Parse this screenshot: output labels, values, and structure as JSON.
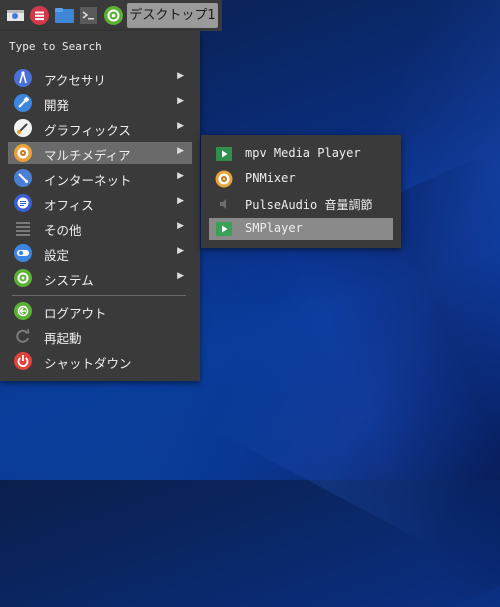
{
  "panel": {
    "workspace_label": "デスクトップ1",
    "buttons": [
      "show-desktop-icon",
      "app-menu-icon",
      "file-manager-icon",
      "terminal-icon",
      "settings-gear-icon"
    ]
  },
  "menu": {
    "search_placeholder": "Type to Search",
    "categories": [
      {
        "label": "アクセサリ",
        "icon": "accessories-icon",
        "has_submenu": true
      },
      {
        "label": "開発",
        "icon": "development-icon",
        "has_submenu": true
      },
      {
        "label": "グラフィックス",
        "icon": "graphics-icon",
        "has_submenu": true
      },
      {
        "label": "マルチメディア",
        "icon": "multimedia-icon",
        "has_submenu": true,
        "active": true
      },
      {
        "label": "インターネット",
        "icon": "internet-icon",
        "has_submenu": true
      },
      {
        "label": "オフィス",
        "icon": "office-icon",
        "has_submenu": true
      },
      {
        "label": "その他",
        "icon": "other-icon",
        "has_submenu": true
      },
      {
        "label": "設定",
        "icon": "settings-icon",
        "has_submenu": true
      },
      {
        "label": "システム",
        "icon": "system-icon",
        "has_submenu": true
      }
    ],
    "actions": [
      {
        "label": "ログアウト",
        "icon": "logout-icon"
      },
      {
        "label": "再起動",
        "icon": "reboot-icon"
      },
      {
        "label": "シャットダウン",
        "icon": "shutdown-icon"
      }
    ]
  },
  "submenu": {
    "items": [
      {
        "label": "mpv Media Player",
        "icon": "mpv-icon"
      },
      {
        "label": "PNMixer",
        "icon": "pnmixer-icon"
      },
      {
        "label": "PulseAudio 音量調節",
        "icon": "speaker-icon"
      },
      {
        "label": "SMPlayer",
        "icon": "smplayer-icon",
        "active": true
      }
    ]
  },
  "colors": {
    "panel_bg": "#3a3a3a",
    "highlight": "#6a6a6a",
    "submenu_highlight": "#8a8a8a",
    "desktop_blue": "#0a2c7a"
  }
}
